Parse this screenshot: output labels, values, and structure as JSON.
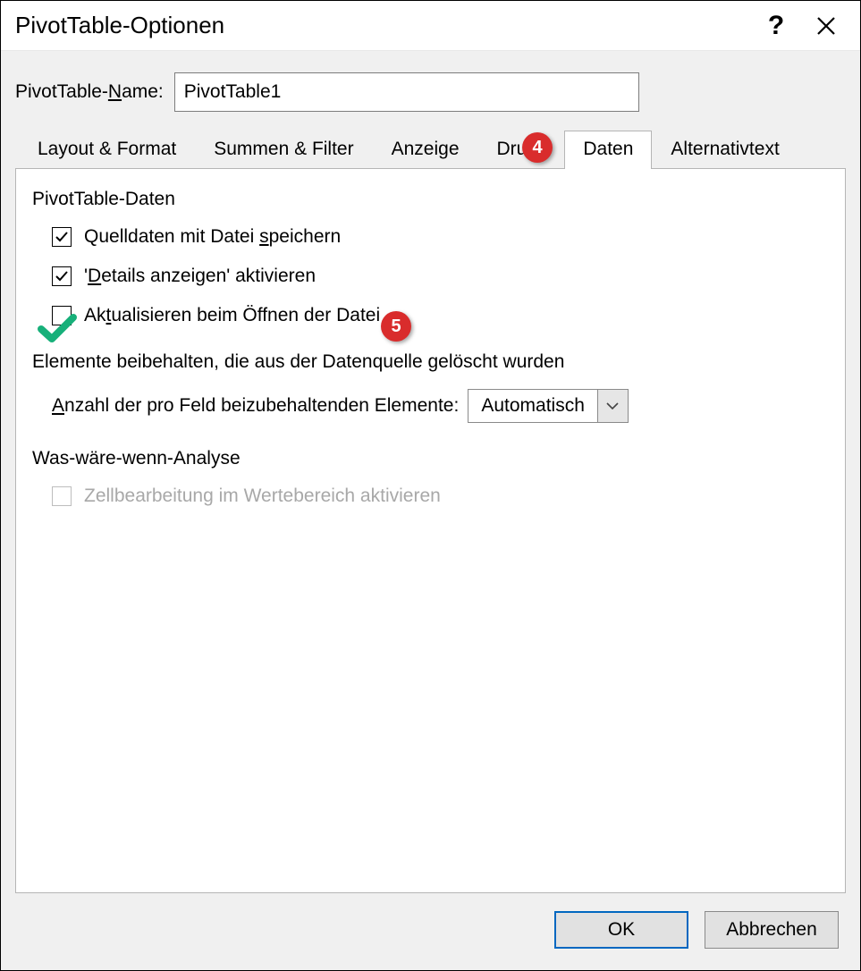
{
  "dialog": {
    "title": "PivotTable-Optionen",
    "name_label": "PivotTable-Name:",
    "name_value": "PivotTable1"
  },
  "tabs": [
    {
      "label": "Layout & Format"
    },
    {
      "label": "Summen & Filter"
    },
    {
      "label": "Anzeige"
    },
    {
      "label": "Druck"
    },
    {
      "label": "Daten"
    },
    {
      "label": "Alternativtext"
    }
  ],
  "sections": {
    "data_title": "PivotTable-Daten",
    "data_checks": [
      {
        "label_pre": "Quelldaten mit Datei ",
        "u": "s",
        "label_post": "peichern",
        "checked": true
      },
      {
        "label_pre": "'",
        "u": "D",
        "label_post": "etails anzeigen' aktivieren",
        "checked": true
      },
      {
        "label_pre": "Ak",
        "u": "t",
        "label_post": "ualisieren beim Öffnen der Datei",
        "checked": false
      }
    ],
    "retain_title": "Elemente beibehalten, die aus der Datenquelle gelöscht wurden",
    "retain_label_pre": "",
    "retain_u": "A",
    "retain_label_post": "nzahl der pro Feld beizubehaltenden Elemente:",
    "retain_value": "Automatisch",
    "whatif_title": "Was-wäre-wenn-Analyse",
    "whatif_check": "Zellbearbeitung im Wertebereich aktivieren"
  },
  "buttons": {
    "ok": "OK",
    "cancel": "Abbrechen"
  },
  "annotations": {
    "badge4": "4",
    "badge5": "5"
  }
}
